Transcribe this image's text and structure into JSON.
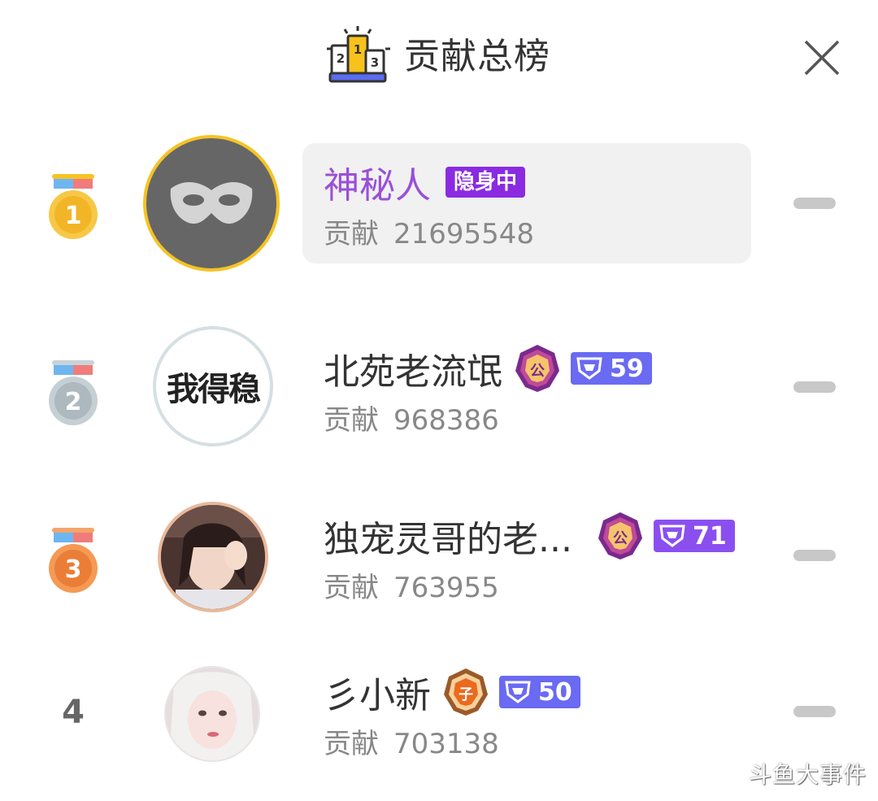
{
  "header": {
    "title": "贡献总榜",
    "icon_digits": [
      "2",
      "1",
      "3"
    ]
  },
  "entries": [
    {
      "rank": "1",
      "name": "神秘人",
      "status_tag": "隐身中",
      "contrib_label": "贡献",
      "contrib_value": "21695548",
      "avatar": "mask-icon"
    },
    {
      "rank": "2",
      "name": "北苑老流氓",
      "avatar_text": "我得稳",
      "contrib_label": "贡献",
      "contrib_value": "968386",
      "badge": "公",
      "level": "59"
    },
    {
      "rank": "3",
      "name": "独宠灵哥的老...",
      "contrib_label": "贡献",
      "contrib_value": "763955",
      "badge": "公",
      "level": "71",
      "avatar": "user-photo"
    },
    {
      "rank": "4",
      "name": "彡小新",
      "contrib_label": "贡献",
      "contrib_value": "703138",
      "badge": "子",
      "level": "50",
      "avatar": "user-photo"
    }
  ],
  "watermark": "斗鱼大事件",
  "colors": {
    "gold": "#f5c324",
    "silver": "#b7c3c8",
    "bronze": "#ef8a44",
    "purple_text": "#9a4fd8",
    "tag_purple": "#8a2be2",
    "level_blue": "#6a6af2",
    "level_violet": "#8b4ff0"
  }
}
